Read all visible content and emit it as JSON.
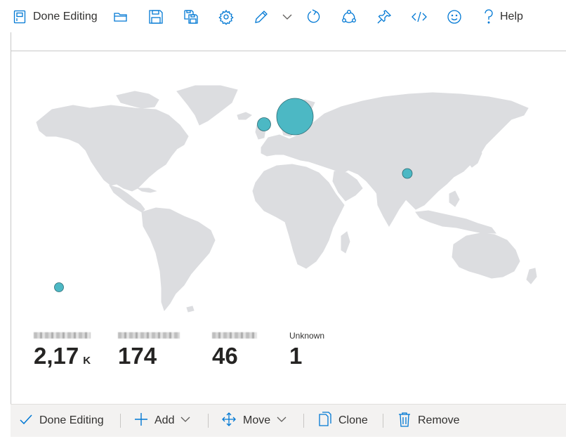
{
  "toolbar": {
    "done_editing_label": "Done Editing",
    "help_label": "Help",
    "icons": [
      "dashboard-icon",
      "open-folder-icon",
      "save-icon",
      "save-all-icon",
      "gear-icon",
      "pencil-icon",
      "chevron-down-icon",
      "refresh-icon",
      "share-icon",
      "pin-icon",
      "code-icon",
      "smiley-icon",
      "help-icon"
    ]
  },
  "map": {
    "bubble_color": "#4cb8c4",
    "land_color": "#dcdde0"
  },
  "legend": [
    {
      "label": "",
      "value": "2,17",
      "suffix": "K"
    },
    {
      "label": "",
      "value": "174",
      "suffix": ""
    },
    {
      "label": "",
      "value": "46",
      "suffix": ""
    },
    {
      "label": "Unknown",
      "value": "1",
      "suffix": ""
    }
  ],
  "bottom_toolbar": {
    "done_editing_label": "Done Editing",
    "add_label": "Add",
    "move_label": "Move",
    "clone_label": "Clone",
    "remove_label": "Remove"
  }
}
